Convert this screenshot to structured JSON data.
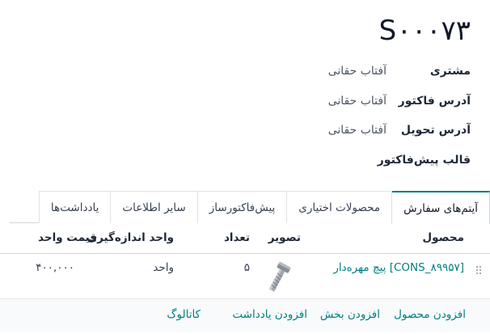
{
  "record": {
    "title": "S۰۰۰۷۳"
  },
  "fields": [
    {
      "label": "مشتری",
      "value": "آفتاب حقانی"
    },
    {
      "label": "آدرس فاکتور",
      "value": "آفتاب حقانی"
    },
    {
      "label": "آدرس تحویل",
      "value": "آفتاب حقانی"
    },
    {
      "label": "قالب پیش‌فاکتور",
      "value": ""
    }
  ],
  "tabs": [
    {
      "label": "آیتم‌های سفارش",
      "active": true
    },
    {
      "label": "محصولات اختیاری",
      "active": false
    },
    {
      "label": "پیش‌فاکتورساز",
      "active": false
    },
    {
      "label": "سایر اطلاعات",
      "active": false
    },
    {
      "label": "یادداشت‌ها",
      "active": false
    }
  ],
  "table": {
    "columns": {
      "product": "محصول",
      "image": "تصویر",
      "quantity": "تعداد",
      "uom": "واحد اندازه‌گیری",
      "unit_price": "قیمت واحد"
    },
    "rows": [
      {
        "product": "[CONS_۸۹۹۵۷] پیچ مهره‌دار",
        "image_icon": "bolt-image",
        "quantity": "۵",
        "uom": "واحد",
        "unit_price": "۴۰۰,۰۰۰"
      }
    ]
  },
  "actions": {
    "add_product": "افزودن محصول",
    "add_section": "افزودن بخش",
    "add_note": "افزودن یادداشت",
    "catalog": "کاتالوگ"
  },
  "colors": {
    "accent": "#017e84",
    "text": "#374151"
  }
}
